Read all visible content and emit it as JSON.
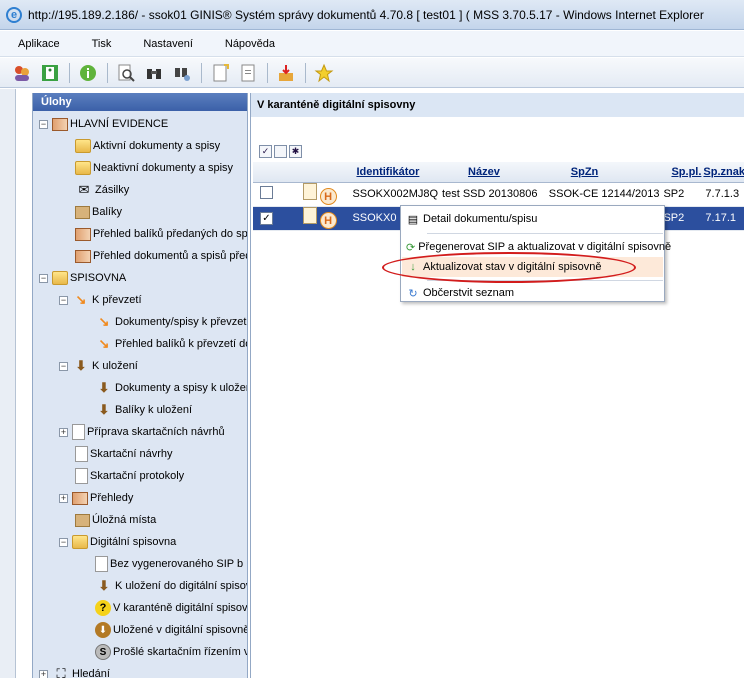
{
  "window": {
    "title": "http://195.189.2.186/ - ssok01 GINIS® Systém správy dokumentů 4.70.8 [ test01 ] ( MSS 3.70.5.17 - Windows Internet Explorer"
  },
  "menu": [
    "Aplikace",
    "Tisk",
    "Nastavení",
    "Nápověda"
  ],
  "sidebar": {
    "header": "Úlohy",
    "items": [
      {
        "label": "HLAVNÍ EVIDENCE"
      },
      {
        "label": "Aktivní dokumenty a spisy"
      },
      {
        "label": "Neaktivní dokumenty a spisy"
      },
      {
        "label": "Zásilky"
      },
      {
        "label": "Balíky"
      },
      {
        "label": "Přehled balíků předaných do sp"
      },
      {
        "label": "Přehled dokumentů a spisů před"
      },
      {
        "label": "SPISOVNA"
      },
      {
        "label": "K převzetí"
      },
      {
        "label": "Dokumenty/spisy k převzet"
      },
      {
        "label": "Přehled balíků k převzetí do"
      },
      {
        "label": "K uložení"
      },
      {
        "label": "Dokumenty a spisy k uložen"
      },
      {
        "label": "Balíky k uložení"
      },
      {
        "label": "Příprava skartačních návrhů"
      },
      {
        "label": "Skartační návrhy"
      },
      {
        "label": "Skartační protokoly"
      },
      {
        "label": "Přehledy"
      },
      {
        "label": "Úložná místa"
      },
      {
        "label": "Digitální spisovna"
      },
      {
        "label": "Bez vygenerovaného SIP b"
      },
      {
        "label": "K uložení do digitální spisov"
      },
      {
        "label": "V karanténě digitální spisov"
      },
      {
        "label": "Uložené v digitální spisovně"
      },
      {
        "label": "Prošlé skartačním řízením v"
      },
      {
        "label": "Hledání"
      }
    ]
  },
  "main": {
    "title": "V karanténě digitální spisovny",
    "columns": [
      "Identifikátor",
      "Název",
      "SpZn",
      "Sp.pl.",
      "Sp.znak"
    ],
    "rows": [
      {
        "id": "SSOKX002MJ8Q",
        "name": "test SSD 20130806",
        "spzn": "SSOK-CE 12144/2013",
        "sppl": "SP2",
        "spznak": "7.7.1.3",
        "checked": false
      },
      {
        "id": "SSOKX0",
        "name": "",
        "spzn": "",
        "sppl": "SP2",
        "spznak": "7.17.1",
        "checked": true
      }
    ]
  },
  "context_menu": {
    "items": [
      "Detail dokumentu/spisu",
      "Přegenerovat SIP a aktualizovat v digitální spisovně",
      "Aktualizovat stav v digitální spisovně",
      "Občerstvit seznam"
    ],
    "highlighted_index": 2
  }
}
